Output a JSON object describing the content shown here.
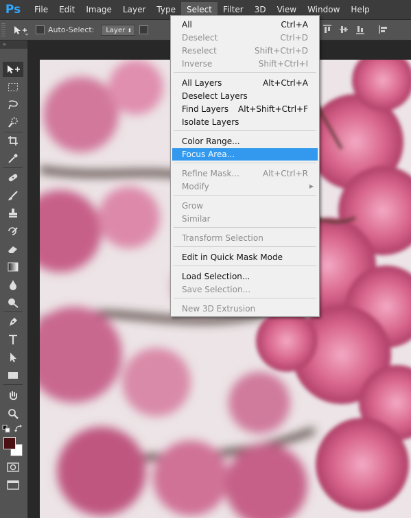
{
  "app": {
    "logo": "Ps"
  },
  "menubar": {
    "items": [
      "File",
      "Edit",
      "Image",
      "Layer",
      "Type",
      "Select",
      "Filter",
      "3D",
      "View",
      "Window",
      "Help"
    ],
    "active": "Select"
  },
  "options": {
    "auto_select_label": "Auto-Select:",
    "layer_select_value": "Layer"
  },
  "panel_tab": "»",
  "colors": {
    "foreground": "#4a0f12",
    "background": "#ffffff",
    "highlight": "#3399ee"
  },
  "select_menu": {
    "items": [
      {
        "label": "All",
        "shortcut": "Ctrl+A",
        "disabled": false
      },
      {
        "label": "Deselect",
        "shortcut": "Ctrl+D",
        "disabled": true
      },
      {
        "label": "Reselect",
        "shortcut": "Shift+Ctrl+D",
        "disabled": true
      },
      {
        "label": "Inverse",
        "shortcut": "Shift+Ctrl+I",
        "disabled": true
      },
      {
        "label": "All Layers",
        "shortcut": "Alt+Ctrl+A",
        "disabled": false
      },
      {
        "label": "Deselect Layers",
        "shortcut": "",
        "disabled": false
      },
      {
        "label": "Find Layers",
        "shortcut": "Alt+Shift+Ctrl+F",
        "disabled": false
      },
      {
        "label": "Isolate Layers",
        "shortcut": "",
        "disabled": false
      },
      {
        "label": "Color Range...",
        "shortcut": "",
        "disabled": false
      },
      {
        "label": "Focus Area...",
        "shortcut": "",
        "disabled": false,
        "highlighted": true
      },
      {
        "label": "Refine Mask...",
        "shortcut": "Alt+Ctrl+R",
        "disabled": true
      },
      {
        "label": "Modify",
        "shortcut": "",
        "disabled": true,
        "submenu": true
      },
      {
        "label": "Grow",
        "shortcut": "",
        "disabled": true
      },
      {
        "label": "Similar",
        "shortcut": "",
        "disabled": true
      },
      {
        "label": "Transform Selection",
        "shortcut": "",
        "disabled": true
      },
      {
        "label": "Edit in Quick Mask Mode",
        "shortcut": "",
        "disabled": false
      },
      {
        "label": "Load Selection...",
        "shortcut": "",
        "disabled": false
      },
      {
        "label": "Save Selection...",
        "shortcut": "",
        "disabled": true
      },
      {
        "label": "New 3D Extrusion",
        "shortcut": "",
        "disabled": true
      }
    ]
  },
  "tools": [
    "move-tool",
    "marquee-tool",
    "lasso-tool",
    "quick-selection-tool",
    "crop-tool",
    "eyedropper-tool",
    "healing-brush-tool",
    "brush-tool",
    "clone-stamp-tool",
    "history-brush-tool",
    "eraser-tool",
    "gradient-tool",
    "blur-tool",
    "dodge-tool",
    "pen-tool",
    "type-tool",
    "path-selection-tool",
    "rectangle-tool",
    "hand-tool",
    "zoom-tool"
  ]
}
